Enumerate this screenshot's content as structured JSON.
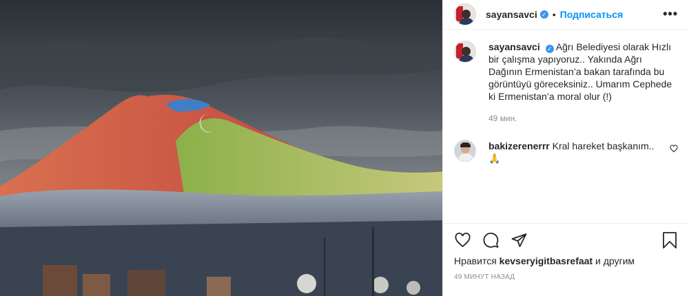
{
  "post": {
    "username": "sayansavci",
    "separator": "•",
    "follow_label": "Подписаться",
    "more_label": "•••"
  },
  "caption": {
    "username": "sayansavci",
    "text": "Ağrı Belediyesi olarak Hızlı bir çalışma yapıyoruz.. Yakında Ağrı Dağının Ermenistan’a bakan tarafında bu görüntüyü göreceksiniz.. Umarım Cephede ki Ermenistan’a moral olur (!)",
    "time": "49 мин."
  },
  "comments": [
    {
      "username": "bakizerenerrr",
      "text": "Kral hareket başkanım..🙏"
    }
  ],
  "likes": {
    "prefix": "Нравится ",
    "user": "kevseryigitbasrefaat",
    "suffix": " и другим"
  },
  "timestamp": "49 МИНУТ НАЗАД",
  "colors": {
    "link": "#0095f6",
    "verified": "#3897f0",
    "muted": "#8e8e8e"
  }
}
